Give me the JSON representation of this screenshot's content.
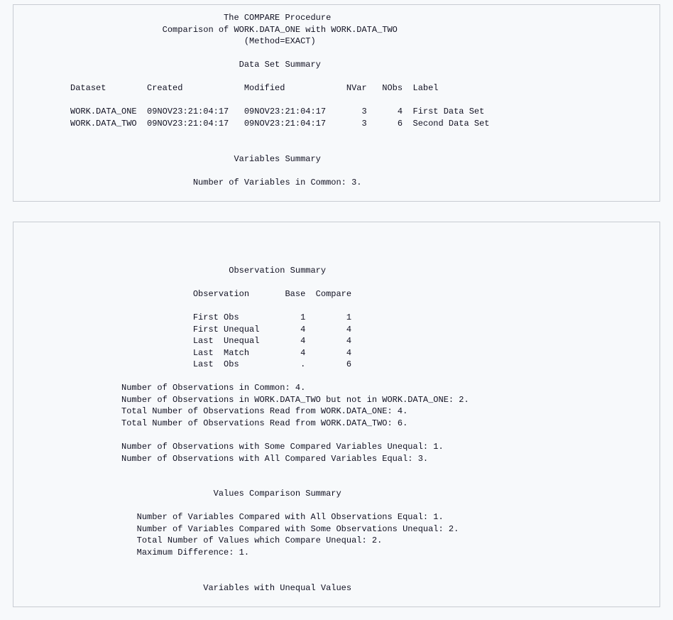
{
  "panel1": {
    "title1": "The COMPARE Procedure",
    "title2": "Comparison of WORK.DATA_ONE with WORK.DATA_TWO",
    "title3": "(Method=EXACT)",
    "section_dataset_summary": "Data Set Summary",
    "ds_header": {
      "dataset": "Dataset",
      "created": "Created",
      "modified": "Modified",
      "nvar": "NVar",
      "nobs": "NObs",
      "label": "Label"
    },
    "ds_rows": [
      {
        "dataset": "WORK.DATA_ONE",
        "created": "09NOV23:21:04:17",
        "modified": "09NOV23:21:04:17",
        "nvar": "3",
        "nobs": "4",
        "label": "First Data Set"
      },
      {
        "dataset": "WORK.DATA_TWO",
        "created": "09NOV23:21:04:17",
        "modified": "09NOV23:21:04:17",
        "nvar": "3",
        "nobs": "6",
        "label": "Second Data Set"
      }
    ],
    "section_variables_summary": "Variables Summary",
    "vars_in_common": "Number of Variables in Common: 3."
  },
  "panel2": {
    "section_observation_summary": "Observation Summary",
    "obs_header": {
      "observation": "Observation",
      "base": "Base",
      "compare": "Compare"
    },
    "obs_rows": [
      {
        "observation": "First Obs",
        "base": "1",
        "compare": "1"
      },
      {
        "observation": "First Unequal",
        "base": "4",
        "compare": "4"
      },
      {
        "observation": "Last  Unequal",
        "base": "4",
        "compare": "4"
      },
      {
        "observation": "Last  Match",
        "base": "4",
        "compare": "4"
      },
      {
        "observation": "Last  Obs",
        "base": ".",
        "compare": "6"
      }
    ],
    "notes_block1": [
      "Number of Observations in Common: 4.",
      "Number of Observations in WORK.DATA_TWO but not in WORK.DATA_ONE: 2.",
      "Total Number of Observations Read from WORK.DATA_ONE: 4.",
      "Total Number of Observations Read from WORK.DATA_TWO: 6."
    ],
    "notes_block2": [
      "Number of Observations with Some Compared Variables Unequal: 1.",
      "Number of Observations with All Compared Variables Equal: 3."
    ],
    "section_values_comparison": "Values Comparison Summary",
    "notes_block3": [
      "Number of Variables Compared with All Observations Equal: 1.",
      "Number of Variables Compared with Some Observations Unequal: 2.",
      "Total Number of Values which Compare Unequal: 2.",
      "Maximum Difference: 1."
    ],
    "section_vars_unequal": "Variables with Unequal Values"
  },
  "layout": {
    "line_width": 102,
    "col_dataset": 15,
    "col_created": 19,
    "col_modified": 19,
    "col_nvar": 5,
    "col_nobs": 7,
    "obs_indent": 34,
    "col_observation": 15,
    "col_base": 7,
    "col_compare": 9,
    "notes_indent": 20
  }
}
